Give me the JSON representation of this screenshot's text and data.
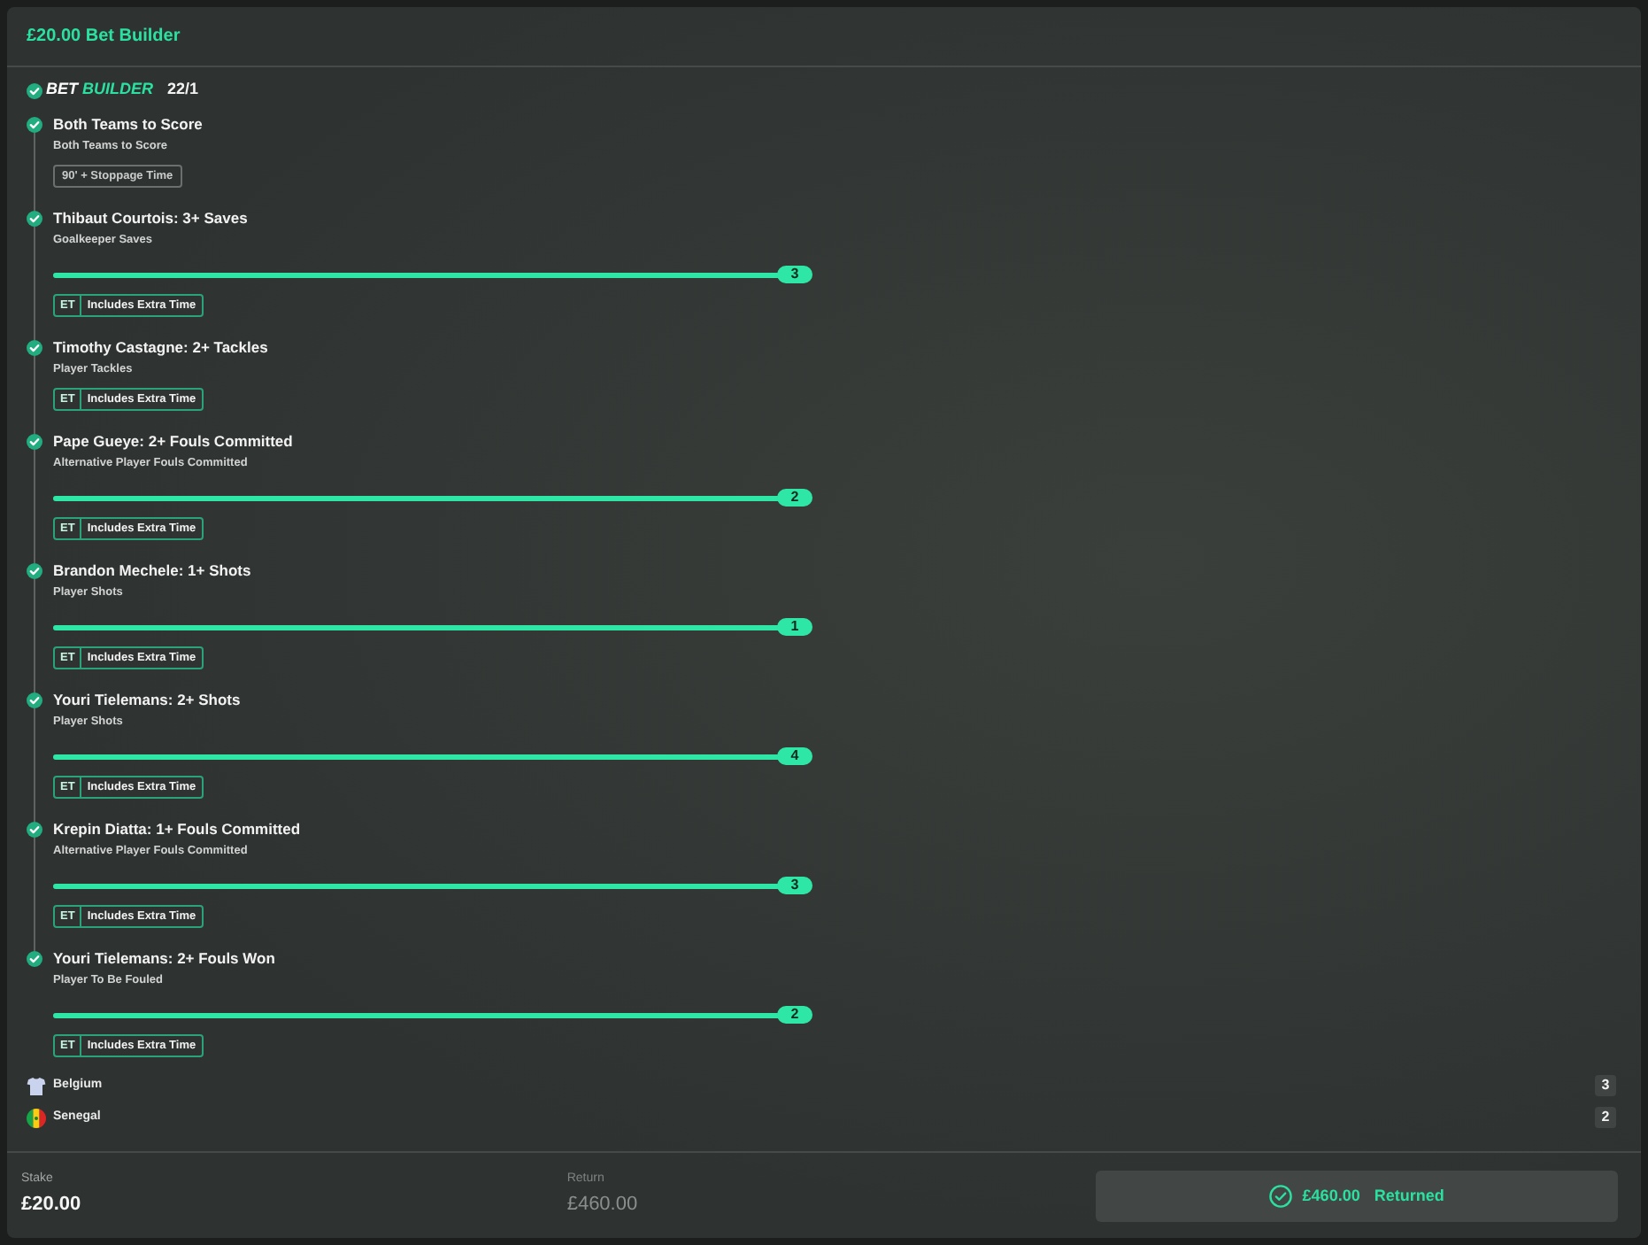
{
  "header": {
    "title": "£20.00 Bet Builder"
  },
  "bet_builder": {
    "logo_words": [
      "BET",
      "BUILDER"
    ],
    "odds": "22/1"
  },
  "legs": [
    {
      "kind": "plain",
      "won": true,
      "title": "Both Teams to Score",
      "market": "Both Teams to Score",
      "tag": {
        "kind": "time",
        "label": "90' + Stoppage Time"
      }
    },
    {
      "kind": "progress",
      "won": true,
      "title": "Thibaut Courtois: 3+ Saves",
      "market": "Goalkeeper Saves",
      "level": 1,
      "reading": "3",
      "tag": {
        "kind": "extra_time",
        "code": "ET",
        "label": "Includes Extra Time"
      }
    },
    {
      "kind": "plain",
      "won": true,
      "title": "Timothy Castagne: 2+ Tackles",
      "market": "Player Tackles",
      "tag": {
        "kind": "extra_time",
        "code": "ET",
        "label": "Includes Extra Time"
      }
    },
    {
      "kind": "progress",
      "won": true,
      "title": "Pape Gueye: 2+ Fouls Committed",
      "market": "Alternative Player Fouls Committed",
      "level": 1,
      "reading": "2",
      "tag": {
        "kind": "extra_time",
        "code": "ET",
        "label": "Includes Extra Time"
      }
    },
    {
      "kind": "progress",
      "won": true,
      "title": "Brandon Mechele: 1+ Shots",
      "market": "Player Shots",
      "level": 1,
      "reading": "1",
      "tag": {
        "kind": "extra_time",
        "code": "ET",
        "label": "Includes Extra Time"
      }
    },
    {
      "kind": "progress",
      "won": true,
      "title": "Youri Tielemans: 2+ Shots",
      "market": "Player Shots",
      "level": 1,
      "reading": "4",
      "tag": {
        "kind": "extra_time",
        "code": "ET",
        "label": "Includes Extra Time"
      }
    },
    {
      "kind": "progress",
      "won": true,
      "title": "Krepin Diatta: 1+ Fouls Committed",
      "market": "Alternative Player Fouls Committed",
      "level": 1,
      "reading": "3",
      "tag": {
        "kind": "extra_time",
        "code": "ET",
        "label": "Includes Extra Time"
      }
    },
    {
      "kind": "progress",
      "won": true,
      "title": "Youri Tielemans: 2+ Fouls Won",
      "market": "Player To Be Fouled",
      "level": 1,
      "reading": "2",
      "tag": {
        "kind": "extra_time",
        "code": "ET",
        "label": "Includes Extra Time"
      }
    }
  ],
  "teams": [
    {
      "kind": "shirt",
      "name": "Belgium",
      "score": "3"
    },
    {
      "kind": "flag",
      "name": "Senegal",
      "score": "2"
    }
  ],
  "footer": {
    "stake_label": "Stake",
    "stake": "£20.00",
    "return_label": "Return",
    "return": "£460.00",
    "status_button": {
      "amount": "£460.00",
      "label": "Returned"
    }
  }
}
